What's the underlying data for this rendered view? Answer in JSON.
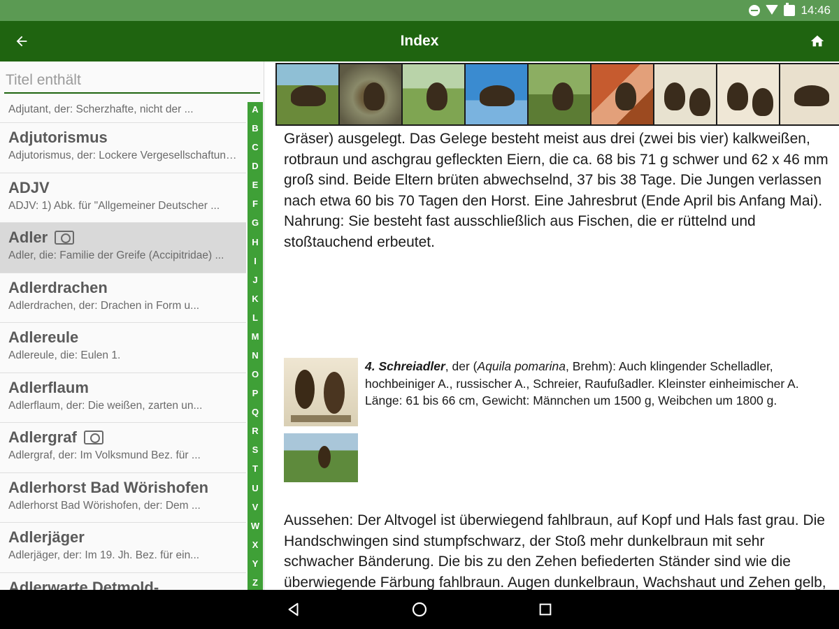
{
  "status_bar": {
    "time": "14:46"
  },
  "app_bar": {
    "title": "Index"
  },
  "search": {
    "placeholder": "Titel enthält"
  },
  "list": {
    "partial_top": "Adjutant, der: Scherzhafte, nicht der ...",
    "items": [
      {
        "title": "Adjutorismus",
        "subtitle": "Adjutorismus, der: Lockere Vergesellschaftung ...",
        "has_image": false,
        "selected": false
      },
      {
        "title": "ADJV",
        "subtitle": "ADJV: 1) Abk. für \"Allgemeiner Deutscher ...",
        "has_image": false,
        "selected": false
      },
      {
        "title": "Adler",
        "subtitle": "Adler, die: Familie der Greife (Accipitridae) ...",
        "has_image": true,
        "selected": true
      },
      {
        "title": "Adlerdrachen",
        "subtitle": "Adlerdrachen, der: Drachen in Form u...",
        "has_image": false,
        "selected": false
      },
      {
        "title": "Adlereule",
        "subtitle": "Adlereule, die: Eulen 1.",
        "has_image": false,
        "selected": false
      },
      {
        "title": "Adlerflaum",
        "subtitle": "Adlerflaum, der: Die weißen, zarten un...",
        "has_image": false,
        "selected": false
      },
      {
        "title": "Adlergraf",
        "subtitle": "Adlergraf, der: Im Volksmund Bez. für ...",
        "has_image": true,
        "selected": false
      },
      {
        "title": "Adlerhorst Bad Wörishofen",
        "subtitle": "Adlerhorst Bad Wörishofen, der: Dem ...",
        "has_image": false,
        "selected": false
      },
      {
        "title": "Adlerjäger",
        "subtitle": "Adlerjäger, der: Im 19. Jh. Bez. für ein...",
        "has_image": false,
        "selected": false
      },
      {
        "title": "Adlerwarte Detmold-",
        "subtitle": "",
        "has_image": false,
        "selected": false
      }
    ]
  },
  "alphabet": [
    "A",
    "B",
    "C",
    "D",
    "E",
    "F",
    "G",
    "H",
    "I",
    "J",
    "K",
    "L",
    "M",
    "N",
    "O",
    "P",
    "Q",
    "R",
    "S",
    "T",
    "U",
    "V",
    "W",
    "X",
    "Y",
    "Z"
  ],
  "article": {
    "para_top": "Gräser) ausgelegt. Das Gelege besteht meist aus drei (zwei bis vier) kalkweißen, rotbraun und aschgrau gefleckten Eiern, die ca. 68 bis 71 g schwer und 62 x 46 mm groß sind. Beide Eltern brüten abwechselnd, 37 bis 38 Tage. Die Jungen verlassen nach etwa 60 bis 70 Tagen den Horst. Eine Jahresbrut (Ende April bis Anfang Mai).",
    "para_nahrung": "Nahrung: Sie besteht fast ausschließlich aus Fischen, die er rüttelnd und stoßtauchend erbeutet.",
    "species_number_name": "4. Schreiadler",
    "species_text_a": ", der (",
    "species_latin": "Aquila pomarina",
    "species_text_b": ", Brehm): Auch klingender Schelladler, hochbeiniger A., russischer A., Schreier, Raufußadler. Kleinster einheimischer A. Länge: 61 bis 66 cm, Gewicht: Männchen um 1500 g, Weibchen um 1800 g.",
    "para_bottom": "Aussehen: Der Altvogel ist überwiegend fahlbraun, auf Kopf und Hals fast grau. Die Handschwingen sind stumpfschwarz, der Stoß mehr dunkelbraun mit sehr schwacher Bänderung. Die bis zu den Zehen befiederten Ständer sind wie die überwiegende Färbung fahlbraun. Augen dunkelbraun, Wachshaut und Zehen gelb, Krallen schwarzgrau. Im Jugendkleid sind Kopf-, Nacken- und Rückenfedern dunkelbraun mit rostgelben Spitzen. Die oberen Stoßfedern sind grau und gelblich"
  },
  "colors": {
    "status_bar": "#5b9a53",
    "app_bar": "#1f6410",
    "alphabet_bar": "#3fa037",
    "nav_bar": "#000000"
  },
  "icons": {
    "back": "arrow-left-icon",
    "home": "home-icon",
    "image": "camera-icon"
  }
}
